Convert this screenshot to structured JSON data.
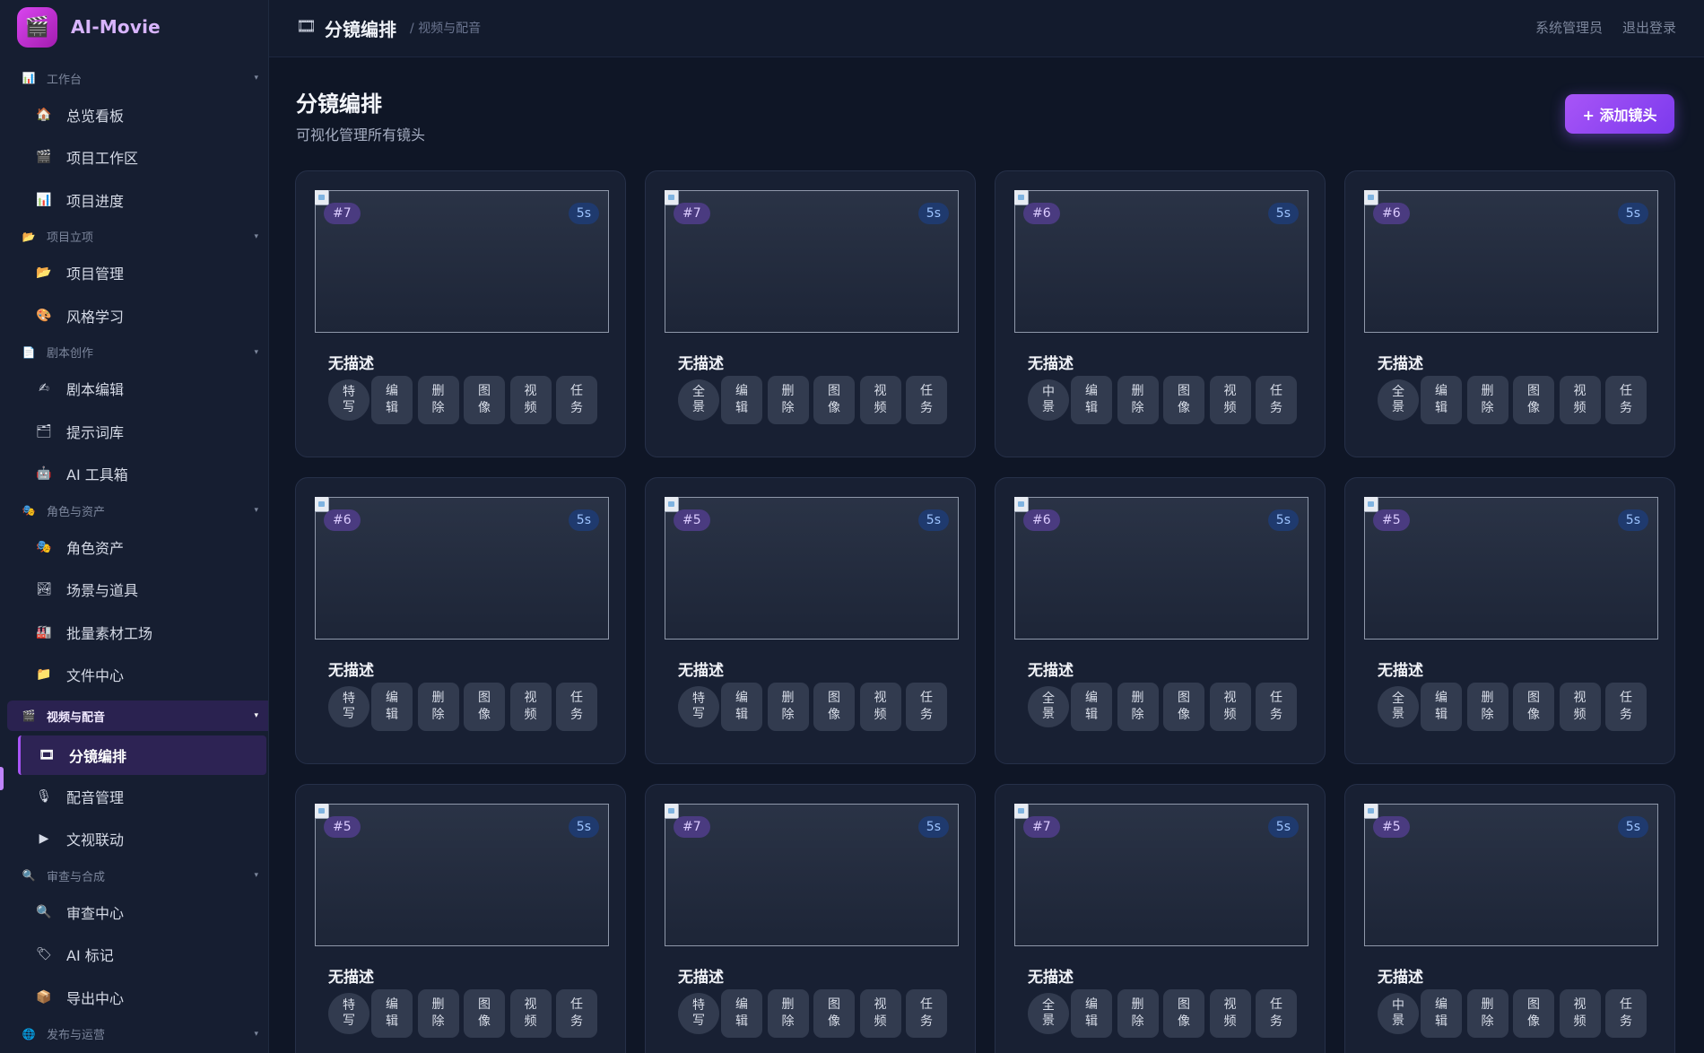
{
  "app": {
    "name": "AI-Movie",
    "logo_icon": "clapperboard-icon"
  },
  "topbar": {
    "title": "分镜编排",
    "breadcrumb": "/ 视频与配音",
    "user": "系统管理员",
    "logout": "退出登录"
  },
  "sidebar": {
    "nav": [
      {
        "type": "group",
        "name": "workbench",
        "label": "工作台",
        "icon": "📊"
      },
      {
        "type": "item",
        "name": "overview",
        "label": "总览看板",
        "icon": "🏠"
      },
      {
        "type": "item",
        "name": "project-workspace",
        "label": "项目工作区",
        "icon": "🎬"
      },
      {
        "type": "item",
        "name": "project-progress",
        "label": "项目进度",
        "icon": "📊"
      },
      {
        "type": "group",
        "name": "project-setup",
        "label": "项目立项",
        "icon": "📂"
      },
      {
        "type": "item",
        "name": "project-management",
        "label": "项目管理",
        "icon": "📂"
      },
      {
        "type": "item",
        "name": "style-learning",
        "label": "风格学习",
        "icon": "🎨"
      },
      {
        "type": "group",
        "name": "script-creation",
        "label": "剧本创作",
        "icon": "📄"
      },
      {
        "type": "item",
        "name": "script-editor",
        "label": "剧本编辑",
        "icon": "✍"
      },
      {
        "type": "item",
        "name": "prompt-library",
        "label": "提示词库",
        "icon": "🗂"
      },
      {
        "type": "item",
        "name": "ai-toolbox",
        "label": "AI 工具箱",
        "icon": "🤖"
      },
      {
        "type": "group",
        "name": "characters-assets",
        "label": "角色与资产",
        "icon": "🎭"
      },
      {
        "type": "item",
        "name": "character-assets",
        "label": "角色资产",
        "icon": "🎭"
      },
      {
        "type": "item",
        "name": "scenes-props",
        "label": "场景与道具",
        "icon": "🏞"
      },
      {
        "type": "item",
        "name": "batch-factory",
        "label": "批量素材工场",
        "icon": "🏭"
      },
      {
        "type": "item",
        "name": "file-center",
        "label": "文件中心",
        "icon": "📁"
      },
      {
        "type": "group",
        "name": "video-dubbing",
        "label": "视频与配音",
        "icon": "🎬",
        "active": true
      },
      {
        "type": "item",
        "name": "storyboard",
        "label": "分镜编排",
        "icon": "🎞",
        "active": true
      },
      {
        "type": "item",
        "name": "dubbing-management",
        "label": "配音管理",
        "icon": "🎙"
      },
      {
        "type": "item",
        "name": "text-video-link",
        "label": "文视联动",
        "icon": "▶"
      },
      {
        "type": "group",
        "name": "review-compose",
        "label": "审查与合成",
        "icon": "🔍"
      },
      {
        "type": "item",
        "name": "review-center",
        "label": "审查中心",
        "icon": "🔍"
      },
      {
        "type": "item",
        "name": "ai-marks",
        "label": "AI 标记",
        "icon": "🏷"
      },
      {
        "type": "item",
        "name": "export-center",
        "label": "导出中心",
        "icon": "📦"
      },
      {
        "type": "group",
        "name": "publish-ops",
        "label": "发布与运营",
        "icon": "🌐"
      }
    ]
  },
  "page": {
    "title": "分镜编排",
    "subtitle": "可视化管理所有镜头",
    "add_button": "+ 添加镜头"
  },
  "actions": [
    "编辑",
    "删除",
    "图像",
    "视频",
    "任务"
  ],
  "shots": [
    {
      "no": "#7",
      "duration": "5s",
      "desc": "无描述",
      "shot_type": "特写"
    },
    {
      "no": "#7",
      "duration": "5s",
      "desc": "无描述",
      "shot_type": "全景"
    },
    {
      "no": "#6",
      "duration": "5s",
      "desc": "无描述",
      "shot_type": "中景"
    },
    {
      "no": "#6",
      "duration": "5s",
      "desc": "无描述",
      "shot_type": "全景"
    },
    {
      "no": "#6",
      "duration": "5s",
      "desc": "无描述",
      "shot_type": "特写"
    },
    {
      "no": "#5",
      "duration": "5s",
      "desc": "无描述",
      "shot_type": "特写"
    },
    {
      "no": "#6",
      "duration": "5s",
      "desc": "无描述",
      "shot_type": "全景"
    },
    {
      "no": "#5",
      "duration": "5s",
      "desc": "无描述",
      "shot_type": "全景"
    },
    {
      "no": "#5",
      "duration": "5s",
      "desc": "无描述",
      "shot_type": "特写"
    },
    {
      "no": "#7",
      "duration": "5s",
      "desc": "无描述",
      "shot_type": "特写"
    },
    {
      "no": "#7",
      "duration": "5s",
      "desc": "无描述",
      "shot_type": "全景"
    },
    {
      "no": "#5",
      "duration": "5s",
      "desc": "无描述",
      "shot_type": "中景"
    }
  ]
}
